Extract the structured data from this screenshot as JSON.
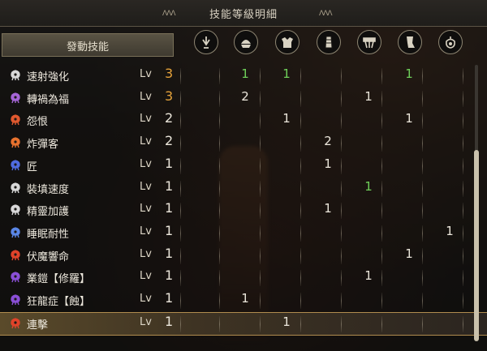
{
  "title": "技能等級明細",
  "title_deco": "ΛΛΛ",
  "active_skills_label": "發動技能",
  "columns": [
    {
      "icon": "weapon-icon"
    },
    {
      "icon": "helm-icon"
    },
    {
      "icon": "chest-icon"
    },
    {
      "icon": "arm-icon"
    },
    {
      "icon": "waist-icon"
    },
    {
      "icon": "leg-icon"
    },
    {
      "icon": "talisman-icon"
    }
  ],
  "lv_label": "Lv",
  "skills": [
    {
      "name": "速射強化",
      "level": "3",
      "max": true,
      "color": "#d8d8d8",
      "cells": [
        "",
        "1",
        "1",
        "",
        "",
        "1",
        ""
      ],
      "green": [
        1,
        2,
        5
      ]
    },
    {
      "name": "轉禍為福",
      "level": "3",
      "max": true,
      "color": "#a565d6",
      "cells": [
        "",
        "2",
        "",
        "",
        "1",
        "",
        ""
      ],
      "green": []
    },
    {
      "name": "怨恨",
      "level": "2",
      "max": false,
      "color": "#e0592f",
      "cells": [
        "",
        "",
        "1",
        "",
        "",
        "1",
        ""
      ],
      "green": []
    },
    {
      "name": "炸彈客",
      "level": "2",
      "max": false,
      "color": "#e8722e",
      "cells": [
        "",
        "",
        "",
        "2",
        "",
        "",
        ""
      ],
      "green": []
    },
    {
      "name": "匠",
      "level": "1",
      "max": false,
      "color": "#4f6be0",
      "cells": [
        "",
        "",
        "",
        "1",
        "",
        "",
        ""
      ],
      "green": []
    },
    {
      "name": "裝填速度",
      "level": "1",
      "max": false,
      "color": "#d8d8d8",
      "cells": [
        "",
        "",
        "",
        "",
        "1",
        "",
        ""
      ],
      "green": [
        4
      ]
    },
    {
      "name": "精靈加護",
      "level": "1",
      "max": false,
      "color": "#d8d8d8",
      "cells": [
        "",
        "",
        "",
        "1",
        "",
        "",
        ""
      ],
      "green": []
    },
    {
      "name": "睡眠耐性",
      "level": "1",
      "max": false,
      "color": "#5a86e6",
      "cells": [
        "",
        "",
        "",
        "",
        "",
        "",
        "1"
      ],
      "green": []
    },
    {
      "name": "伏魔響命",
      "level": "1",
      "max": false,
      "color": "#e0432a",
      "cells": [
        "",
        "",
        "",
        "",
        "",
        "1",
        ""
      ],
      "green": []
    },
    {
      "name": "業鎧【修羅】",
      "level": "1",
      "max": false,
      "color": "#8a4fd6",
      "cells": [
        "",
        "",
        "",
        "",
        "1",
        "",
        ""
      ],
      "green": []
    },
    {
      "name": "狂龍症【蝕】",
      "level": "1",
      "max": false,
      "color": "#8a4fd6",
      "cells": [
        "",
        "1",
        "",
        "",
        "",
        "",
        ""
      ],
      "green": []
    },
    {
      "name": "連擊",
      "level": "1",
      "max": false,
      "color": "#e0432a",
      "cells": [
        "",
        "",
        "1",
        "",
        "",
        "",
        ""
      ],
      "green": [],
      "highlight": true
    }
  ]
}
